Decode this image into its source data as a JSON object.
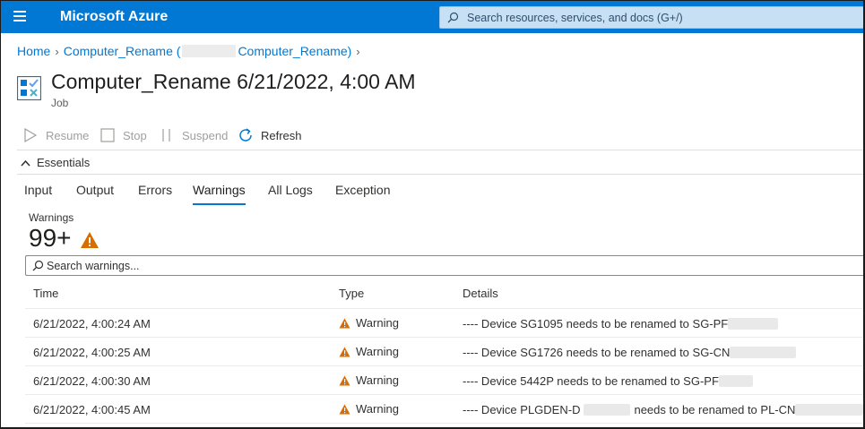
{
  "topbar": {
    "brand": "Microsoft Azure",
    "search_placeholder": "Search resources, services, and docs (G+/)"
  },
  "breadcrumb": {
    "home": "Home",
    "runbook_prefix": "Computer_Rename (",
    "runbook_suffix": "Computer_Rename)"
  },
  "header": {
    "title": "Computer_Rename 6/21/2022, 4:00 AM",
    "subtitle": "Job"
  },
  "commands": {
    "resume": "Resume",
    "stop": "Stop",
    "suspend": "Suspend",
    "refresh": "Refresh"
  },
  "essentials_label": "Essentials",
  "tabs": [
    "Input",
    "Output",
    "Errors",
    "Warnings",
    "All Logs",
    "Exception"
  ],
  "active_tab": "Warnings",
  "stats": {
    "label": "Warnings",
    "count": "99+"
  },
  "search": {
    "placeholder": "Search warnings..."
  },
  "table": {
    "columns": [
      "Time",
      "Type",
      "Details"
    ],
    "rows": [
      {
        "time": "6/21/2022, 4:00:24 AM",
        "type": "Warning",
        "details": "---- Device SG1095 needs to be renamed to SG-PF"
      },
      {
        "time": "6/21/2022, 4:00:25 AM",
        "type": "Warning",
        "details": "---- Device SG1726 needs to be renamed to SG-CN"
      },
      {
        "time": "6/21/2022, 4:00:30 AM",
        "type": "Warning",
        "details": "---- Device 5442P needs to be renamed to SG-PF"
      },
      {
        "time": "6/21/2022, 4:00:45 AM",
        "type": "Warning",
        "details_a": "---- Device PLGDEN-D",
        "details_b": "needs to be renamed to PL-CN"
      }
    ]
  },
  "colors": {
    "azure_blue": "#0078d4",
    "warning_orange": "#d86c00"
  }
}
